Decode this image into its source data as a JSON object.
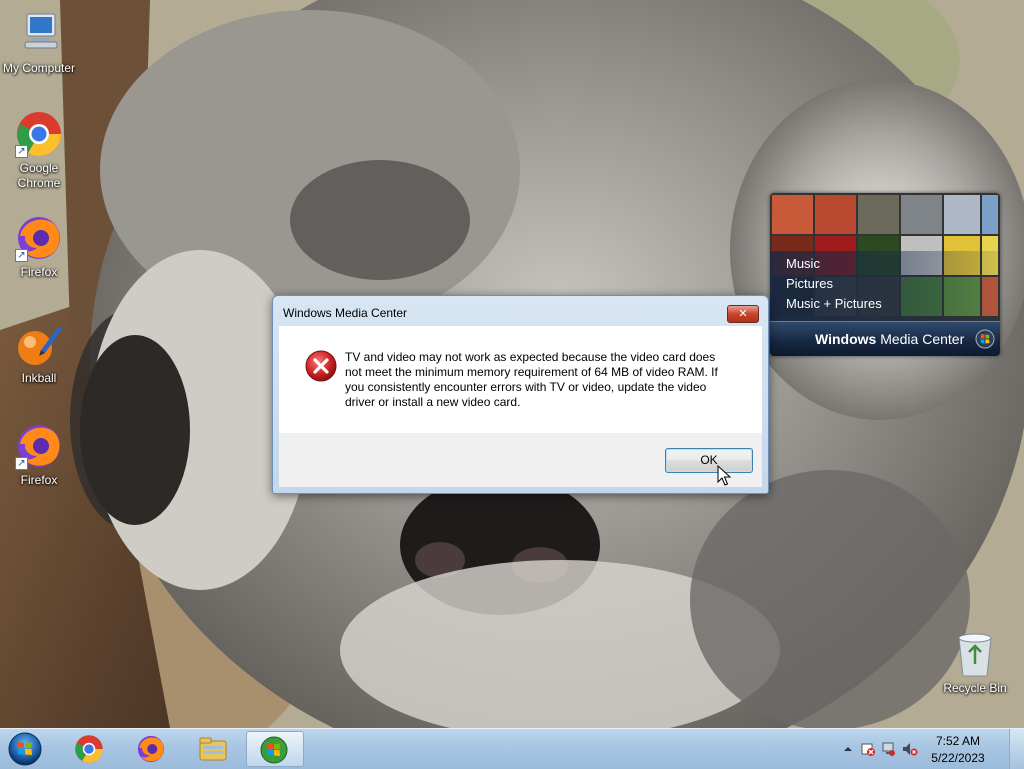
{
  "desktop": {
    "icons": [
      {
        "label": "My Computer",
        "icon": "computer-icon"
      },
      {
        "label": "Google Chrome",
        "icon": "chrome-icon"
      },
      {
        "label": "Firefox",
        "icon": "firefox-icon"
      },
      {
        "label": "Inkball",
        "icon": "inkball-icon"
      },
      {
        "label": "Firefox",
        "icon": "firefox-icon"
      },
      {
        "label": "Recycle Bin",
        "icon": "recycle-bin-icon"
      }
    ]
  },
  "gadget": {
    "items": [
      "Music",
      "Pictures",
      "Music + Pictures"
    ],
    "title_bold": "Windows",
    "title_rest": " Media Center"
  },
  "dialog": {
    "title": "Windows Media Center",
    "close_label": "✕",
    "message": "TV and video may not work as expected because the video card does not meet the minimum memory requirement of 64 MB of video RAM. If you consistently encounter errors with TV or video, update the video driver or install a new video card.",
    "ok_label": "OK"
  },
  "taskbar": {
    "pinned": [
      "chrome-icon",
      "firefox-icon",
      "explorer-icon",
      "media-center-icon"
    ],
    "tray_icons": [
      "show-hidden-icons-icon",
      "action-center-icon",
      "network-icon",
      "volume-muted-icon"
    ],
    "time": "7:52 AM",
    "date": "5/22/2023"
  },
  "colors": {
    "taskbar": "#a8c6e3",
    "dialog_frame": "#c3d7ec",
    "error_red": "#c8262a",
    "button_border": "#3c7fb1"
  }
}
